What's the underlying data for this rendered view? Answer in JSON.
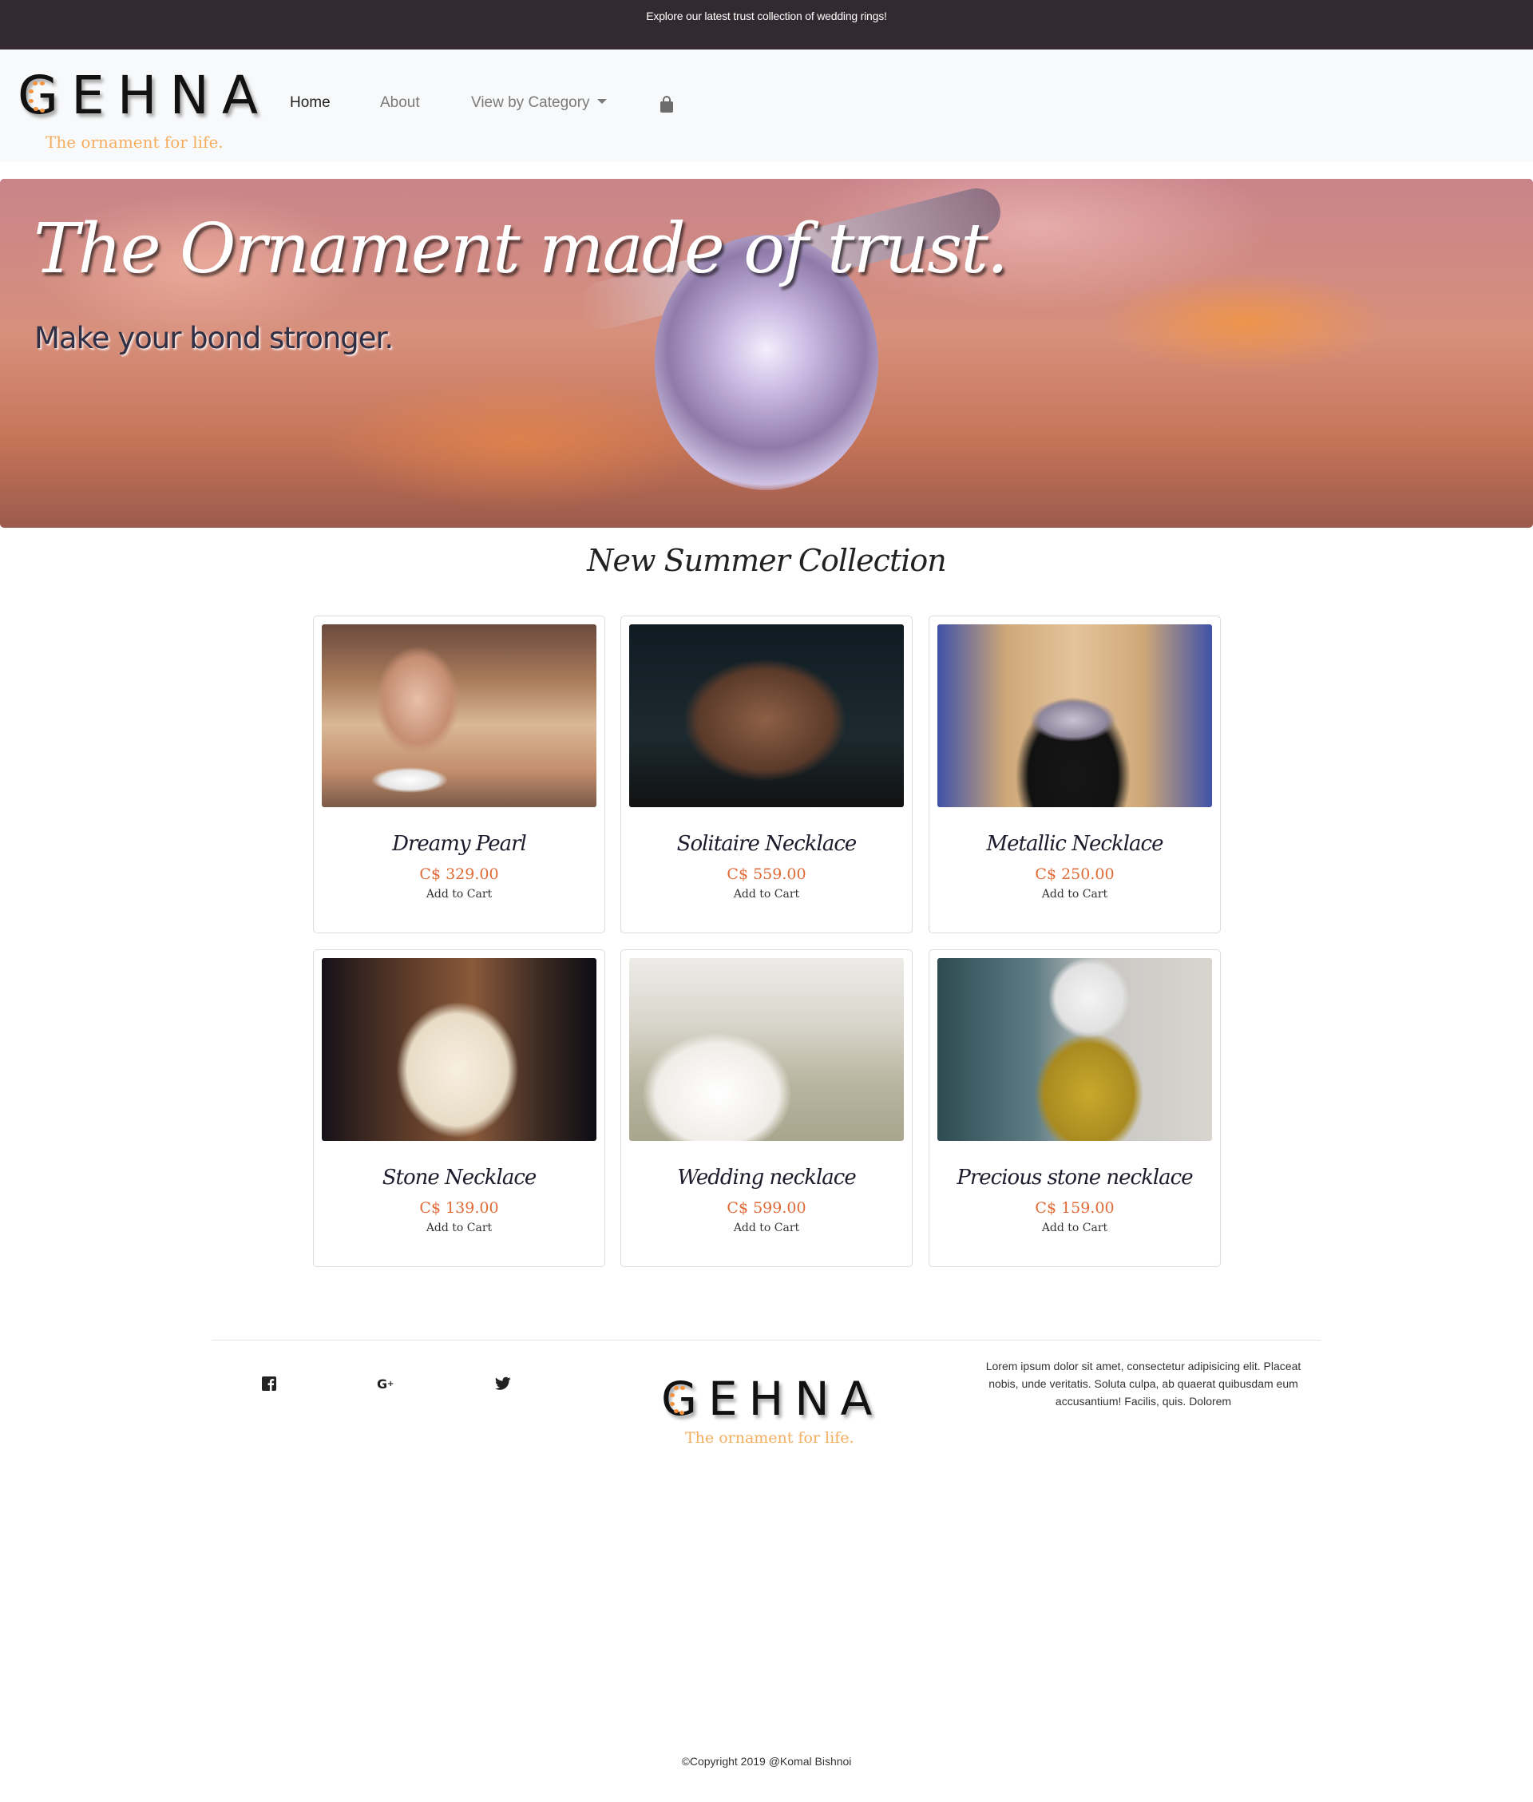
{
  "announcement": "Explore our latest trust collection of wedding rings!",
  "brand": {
    "name": "GEHNA",
    "tagline": "The ornament for life.",
    "accent_color": "#f3923f"
  },
  "nav": {
    "items": [
      {
        "label": "Home",
        "active": true
      },
      {
        "label": "About",
        "active": false
      },
      {
        "label": "View by Category",
        "dropdown": true,
        "active": false
      }
    ],
    "cart_icon": "shopping-bag-icon"
  },
  "hero": {
    "title": "The Ornament made of trust.",
    "subtitle": "Make your bond stronger."
  },
  "collection": {
    "title": "New Summer Collection",
    "products": [
      {
        "name": "Dreamy Pearl",
        "price": "C$ 329.00",
        "action": "Add to Cart"
      },
      {
        "name": "Solitaire Necklace",
        "price": "C$ 559.00",
        "action": "Add to Cart"
      },
      {
        "name": "Metallic Necklace",
        "price": "C$ 250.00",
        "action": "Add to Cart"
      },
      {
        "name": "Stone Necklace",
        "price": "C$ 139.00",
        "action": "Add to Cart"
      },
      {
        "name": "Wedding necklace",
        "price": "C$ 599.00",
        "action": "Add to Cart"
      },
      {
        "name": "Precious stone necklace",
        "price": "C$ 159.00",
        "action": "Add to Cart"
      }
    ],
    "price_color": "#e06a35"
  },
  "footer": {
    "social": [
      "facebook-icon",
      "google-plus-icon",
      "twitter-icon"
    ],
    "about_text": "Lorem ipsum dolor sit amet, consectetur adipisicing elit. Placeat nobis, unde veritatis. Soluta culpa, ab quaerat quibusdam eum accusantium! Facilis, quis. Dolorem",
    "copyright": "©Copyright 2019 @Komal Bishnoi"
  }
}
